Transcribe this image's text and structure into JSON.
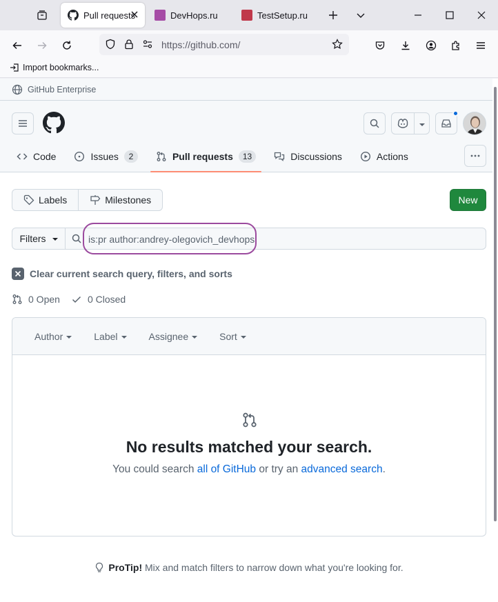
{
  "browser": {
    "tabs": [
      {
        "title": "Pull requests",
        "active": true,
        "favicon": "github-icon"
      },
      {
        "title": "DevHops.ru",
        "active": false,
        "favicon_color": "#a64ca6"
      },
      {
        "title": "TestSetup.ru",
        "active": false,
        "favicon_color": "#c0394b"
      }
    ],
    "url": "https://github.com/",
    "bookmark": "Import bookmarks..."
  },
  "enterprise_bar": {
    "label": "GitHub Enterprise"
  },
  "repo_nav": {
    "code": "Code",
    "issues": "Issues",
    "issues_count": "2",
    "pull_requests": "Pull requests",
    "pull_requests_count": "13",
    "discussions": "Discussions",
    "actions": "Actions"
  },
  "toolbar": {
    "labels": "Labels",
    "milestones": "Milestones",
    "new": "New"
  },
  "search": {
    "filters": "Filters",
    "query": "is:pr author:andrey-olegovich_devhops"
  },
  "clear_filters": "Clear current search query, filters, and sorts",
  "states": {
    "open": "0 Open",
    "closed": "0 Closed"
  },
  "list_header": {
    "author": "Author",
    "label": "Label",
    "assignee": "Assignee",
    "sort": "Sort"
  },
  "blankslate": {
    "title": "No results matched your search.",
    "desc_prefix": "You could search ",
    "link_all": "all of GitHub",
    "desc_middle": " or try an ",
    "link_advanced": "advanced search",
    "desc_suffix": "."
  },
  "protip": {
    "label": "ProTip!",
    "text": " Mix and match filters to narrow down what you're looking for."
  },
  "colors": {
    "primary_button": "#1f883d",
    "link": "#0969da",
    "selected_tab_underline": "#fd8c73",
    "annotation_oval": "#9b4a9e"
  }
}
